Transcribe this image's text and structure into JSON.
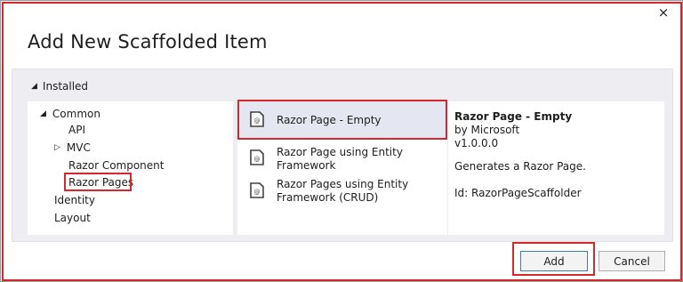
{
  "dialog": {
    "title": "Add New Scaffolded Item",
    "close_glyph": "×"
  },
  "installed_label": "Installed",
  "tree": {
    "items": [
      {
        "label": "Common",
        "expander": "▲"
      },
      {
        "label": "API"
      },
      {
        "label": "MVC",
        "expander": "▷"
      },
      {
        "label": "Razor Component"
      },
      {
        "label": "Razor Pages"
      },
      {
        "label": "Identity"
      },
      {
        "label": "Layout"
      }
    ]
  },
  "templates": [
    {
      "label": "Razor Page - Empty",
      "icon": "razor-file-icon"
    },
    {
      "label_line1": "Razor Page using Entity",
      "label_line2": "Framework",
      "icon": "razor-file-icon"
    },
    {
      "label_line1": "Razor Pages using Entity",
      "label_line2": "Framework (CRUD)",
      "icon": "razor-file-icon"
    }
  ],
  "details": {
    "title": "Razor Page - Empty",
    "author": "by Microsoft",
    "version": "v1.0.0.0",
    "description": "Generates a Razor Page.",
    "id": "Id: RazorPageScaffolder"
  },
  "buttons": {
    "add": "Add",
    "cancel": "Cancel"
  },
  "colors": {
    "highlight": "#d2282e",
    "panel_bg": "#eeeef2",
    "selected_bg": "#e4e6f1"
  }
}
